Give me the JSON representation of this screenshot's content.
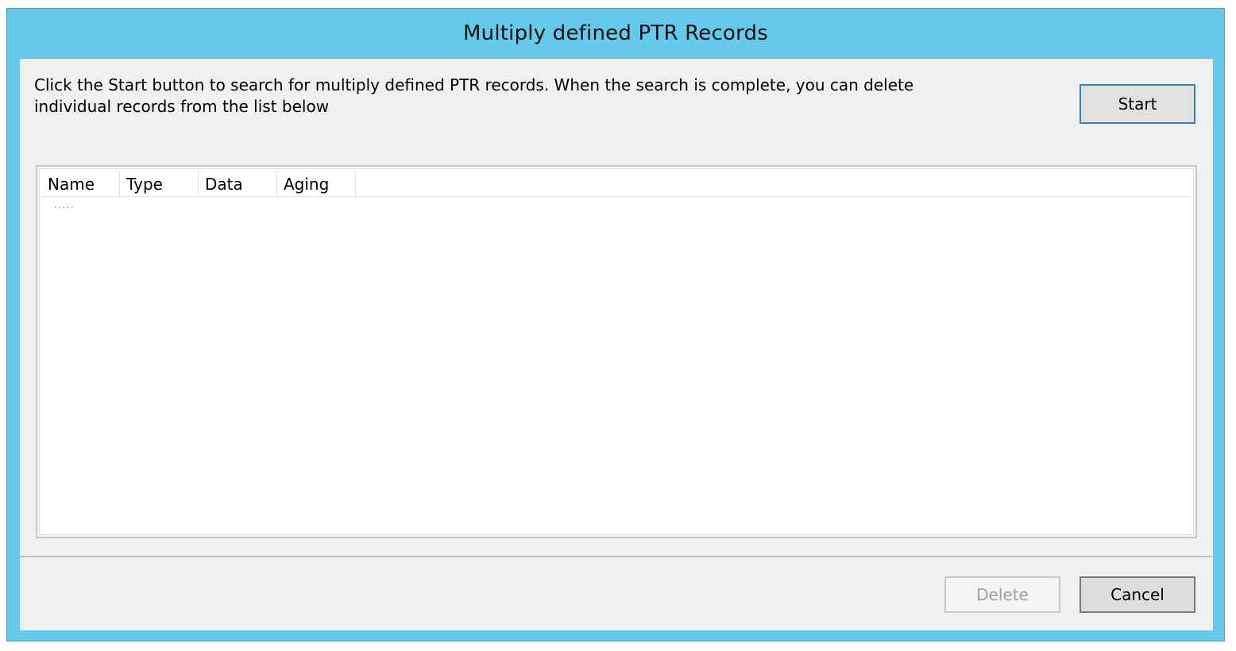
{
  "window": {
    "title": "Multiply defined PTR Records"
  },
  "instructions": {
    "text": "Click the Start button to search for multiply defined PTR records.  When the search is complete, you can delete individual records from the list below"
  },
  "buttons": {
    "start": "Start",
    "delete": "Delete",
    "cancel": "Cancel"
  },
  "list": {
    "columns": [
      "Name",
      "Type",
      "Data",
      "Aging"
    ],
    "placeholder": "....."
  },
  "colors": {
    "titlebar": "#66c9ea",
    "client": "#f0f0f0"
  }
}
